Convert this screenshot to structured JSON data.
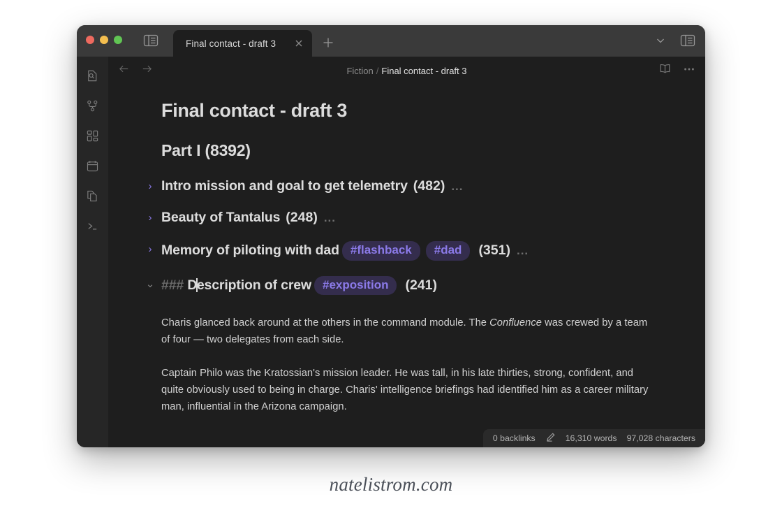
{
  "window": {
    "traffic_lights": [
      "close",
      "minimize",
      "maximize"
    ],
    "colors": {
      "red": "#ee6a5f",
      "yellow": "#f4be4f",
      "green": "#61c554",
      "accent_purple": "#8b7ae8",
      "tag_bg": "#342d4d",
      "titlebar_bg": "#3a3a3a",
      "ribbon_bg": "#262626",
      "editor_bg": "#1e1e1e",
      "statusbar_bg": "#2a2a2a"
    }
  },
  "titlebar": {
    "left_sidebar_toggle": "toggle-left-sidebar",
    "tab": {
      "label": "Final contact - draft 3",
      "close": "close-tab",
      "active": true
    },
    "new_tab": "new-tab",
    "chevron_down": "tab-list-dropdown",
    "right_sidebar_toggle": "toggle-right-sidebar"
  },
  "ribbon": {
    "items": [
      {
        "name": "quick-switcher-icon",
        "label": "Quick switcher"
      },
      {
        "name": "graph-view-icon",
        "label": "Graph view"
      },
      {
        "name": "canvas-icon",
        "label": "Canvas"
      },
      {
        "name": "daily-note-icon",
        "label": "Daily note"
      },
      {
        "name": "templates-icon",
        "label": "Templates"
      },
      {
        "name": "terminal-icon",
        "label": "Terminal"
      }
    ]
  },
  "viewheader": {
    "back": "navigate-back",
    "forward": "navigate-forward",
    "breadcrumb": {
      "folder": "Fiction",
      "separator": "/",
      "current": "Final contact - draft 3"
    },
    "reading_mode": "reading-mode-icon",
    "more_options": "more-options-icon"
  },
  "document": {
    "title": "Final contact - draft 3",
    "heading_part": "Part I (8392)",
    "sections": [
      {
        "fold": "collapsed",
        "fold_glyph": "›",
        "text": "Intro mission and goal to get telemetry",
        "count": "(482)",
        "tags": [],
        "ellipsis": "..."
      },
      {
        "fold": "collapsed",
        "fold_glyph": "›",
        "text": "Beauty of Tantalus",
        "count": "(248)",
        "tags": [],
        "ellipsis": "..."
      },
      {
        "fold": "collapsed",
        "fold_glyph": "›",
        "text": "Memory of piloting with dad",
        "count": "(351)",
        "tags": [
          "#flashback",
          "#dad"
        ],
        "ellipsis": "..."
      },
      {
        "fold": "expanded",
        "fold_glyph": "⌄",
        "markdown_prefix": "###",
        "text_before_caret": "D",
        "text_after_caret": "escription of crew",
        "count": "(241)",
        "tags": [
          "#exposition"
        ],
        "ellipsis": ""
      }
    ],
    "paragraphs": [
      {
        "before_italic": "Charis glanced back around at the others in the command module. The ",
        "italic": "Confluence",
        "after_italic": " was crewed by a team of four — two delegates from each side."
      },
      {
        "before_italic": "Captain Philo was the Kratossian's mission leader. He was tall, in his late thirties, strong, confident, and quite obviously used to being in charge. Charis' intelligence briefings had identified him as a career military man, influential in the Arizona campaign.",
        "italic": "",
        "after_italic": ""
      }
    ]
  },
  "statusbar": {
    "backlinks": "0 backlinks",
    "edit_icon": "pencil-icon",
    "words": "16,310 words",
    "characters": "97,028 characters"
  },
  "watermark": {
    "text": "natelistrom.com"
  }
}
